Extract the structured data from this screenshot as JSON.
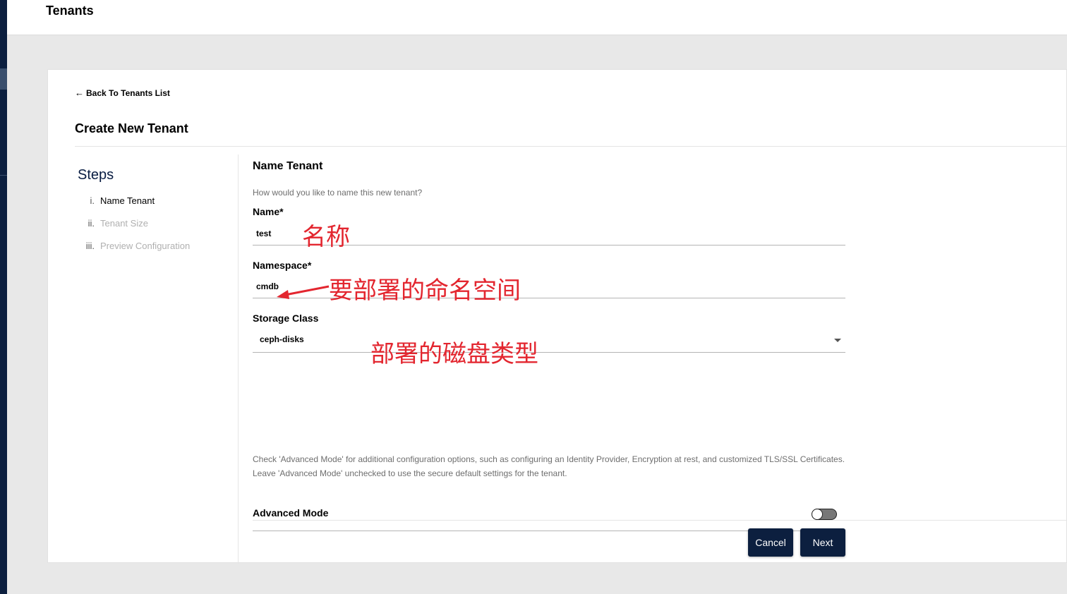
{
  "header": {
    "title": "Tenants"
  },
  "back_link": {
    "arrow": "←",
    "label": "Back To Tenants List"
  },
  "page_title": "Create New Tenant",
  "steps": {
    "title": "Steps",
    "items": [
      {
        "num": "i.",
        "label": "Name Tenant",
        "state": "active"
      },
      {
        "num": "ii.",
        "label": "Tenant Size",
        "state": "inactive"
      },
      {
        "num": "iii.",
        "label": "Preview Configuration",
        "state": "inactive"
      }
    ]
  },
  "form": {
    "section_title": "Name Tenant",
    "help": "How would you like to name this new tenant?",
    "name": {
      "label": "Name*",
      "value": "test"
    },
    "namespace": {
      "label": "Namespace*",
      "value": "cmdb"
    },
    "storage_class": {
      "label": "Storage Class",
      "value": "ceph-disks"
    },
    "advanced_note_1": "Check 'Advanced Mode' for additional configuration options, such as configuring an Identity Provider, Encryption at rest, and customized TLS/SSL Certificates.",
    "advanced_note_2": "Leave 'Advanced Mode' unchecked to use the secure default settings for the tenant.",
    "advanced_mode": {
      "label": "Advanced Mode",
      "enabled": false
    }
  },
  "buttons": {
    "cancel": "Cancel",
    "next": "Next"
  },
  "annotations": {
    "name_note": "名称",
    "namespace_note": "要部署的命名空间",
    "storage_note": "部署的磁盘类型",
    "color": "#e3262f"
  },
  "colors": {
    "navy": "#0c1f3f",
    "background": "#e8e8e8"
  }
}
